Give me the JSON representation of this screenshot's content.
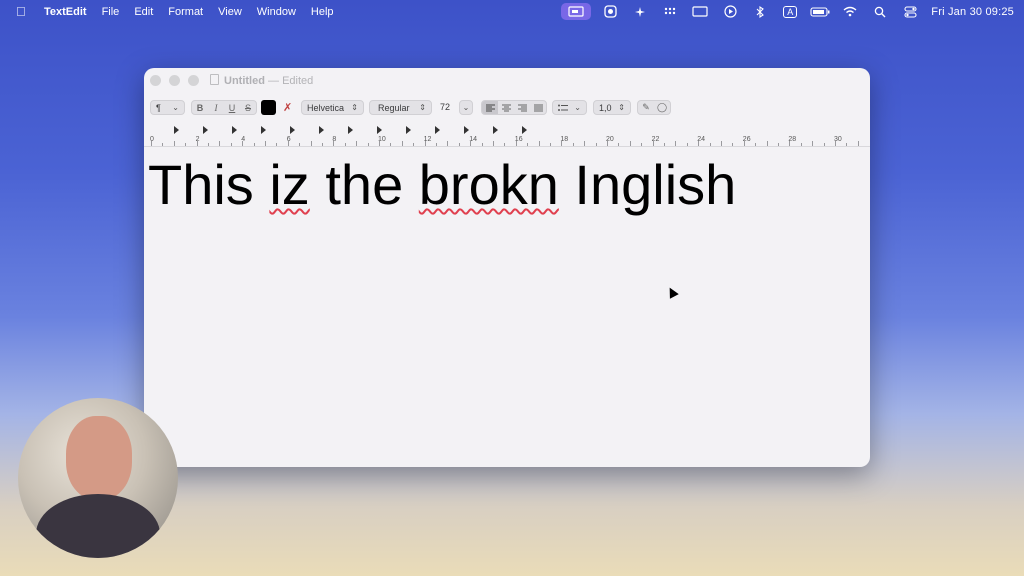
{
  "menubar": {
    "app": "TextEdit",
    "menus": [
      "File",
      "Edit",
      "Format",
      "View",
      "Window",
      "Help"
    ],
    "status_icons": [
      "screen-mirror-icon",
      "record-icon",
      "magic-icon",
      "grid-icon",
      "display-icon",
      "play-icon",
      "bluetooth-icon",
      "input-source-icon",
      "battery-icon",
      "wifi-icon",
      "search-icon",
      "control-center-icon"
    ],
    "input_source": "A",
    "clock": "Fri Jan 30  09:25"
  },
  "window": {
    "title": "Untitled",
    "title_sep": "—",
    "title_status": "Edited"
  },
  "toolbar": {
    "paragraph_style": "¶",
    "bold": "B",
    "italic": "I",
    "underline": "U",
    "strike": "S",
    "font_family": "Helvetica",
    "font_style": "Regular",
    "font_size": "72",
    "line_spacing": "1,0",
    "text_color": "#000000"
  },
  "ruler": {
    "labels": [
      "0",
      "2",
      "4",
      "6",
      "8",
      "10",
      "12",
      "14",
      "16",
      "18",
      "20",
      "22",
      "24",
      "26",
      "28",
      "30"
    ]
  },
  "document": {
    "words": [
      {
        "text": "This ",
        "misspelled": false
      },
      {
        "text": "iz",
        "misspelled": true
      },
      {
        "text": " the ",
        "misspelled": false
      },
      {
        "text": "brokn",
        "misspelled": true
      },
      {
        "text": " Inglish",
        "misspelled": false
      }
    ]
  }
}
